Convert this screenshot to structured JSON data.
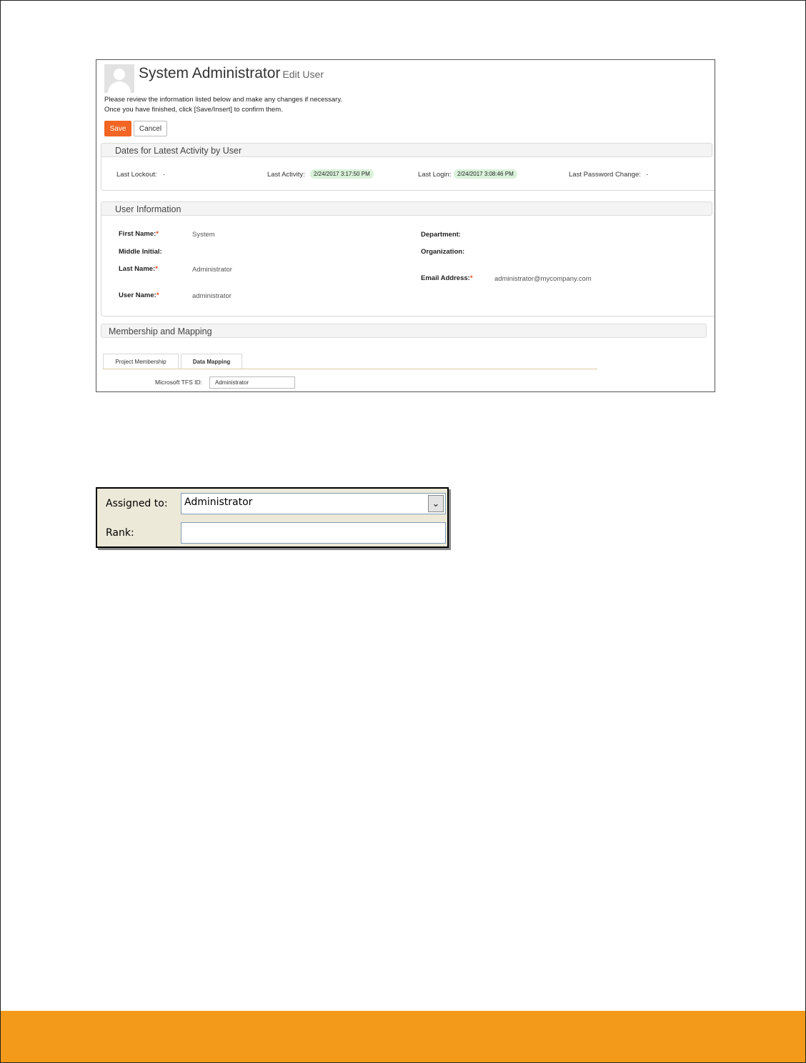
{
  "edit_user": {
    "name": "System Administrator",
    "subtitle": "Edit User",
    "intro_line1": "Please review the information listed below and make any changes if necessary.",
    "intro_line2": "Once you have finished, click [Save/Insert] to confirm them.",
    "save_label": "Save",
    "cancel_label": "Cancel",
    "save_color": "#f26522"
  },
  "activity": {
    "heading": "Dates for Latest Activity by User",
    "last_lockout_label": "Last Lockout:",
    "last_lockout_value": "-",
    "last_activity_label": "Last Activity:",
    "last_activity_value": "2/24/2017 3:17:50 PM",
    "last_login_label": "Last Login:",
    "last_login_value": "2/24/2017 3:08:46 PM",
    "last_password_label": "Last Password Change:",
    "last_password_value": "-"
  },
  "user_info": {
    "heading": "User Information",
    "first_name_label": "First Name:",
    "first_name_value": "System",
    "middle_initial_label": "Middle Initial:",
    "last_name_label": "Last Name:",
    "last_name_value": "Administrator",
    "user_name_label": "User Name:",
    "user_name_value": "administrator",
    "department_label": "Department:",
    "organization_label": "Organization:",
    "email_label": "Email Address:",
    "email_value": "administrator@mycompany.com",
    "required_marker": "*"
  },
  "membership": {
    "heading": "Membership and Mapping",
    "tabs": [
      {
        "label": "Project Membership",
        "active": false
      },
      {
        "label": "Data Mapping",
        "active": true
      }
    ],
    "tfs_label": "Microsoft TFS ID:",
    "tfs_value": "Administrator"
  },
  "tfs_dialog": {
    "assigned_label": "Assigned to:",
    "assigned_value": "Administrator",
    "rank_label": "Rank:",
    "rank_value": ""
  },
  "footer": {
    "bar_color": "#f39a1a"
  }
}
